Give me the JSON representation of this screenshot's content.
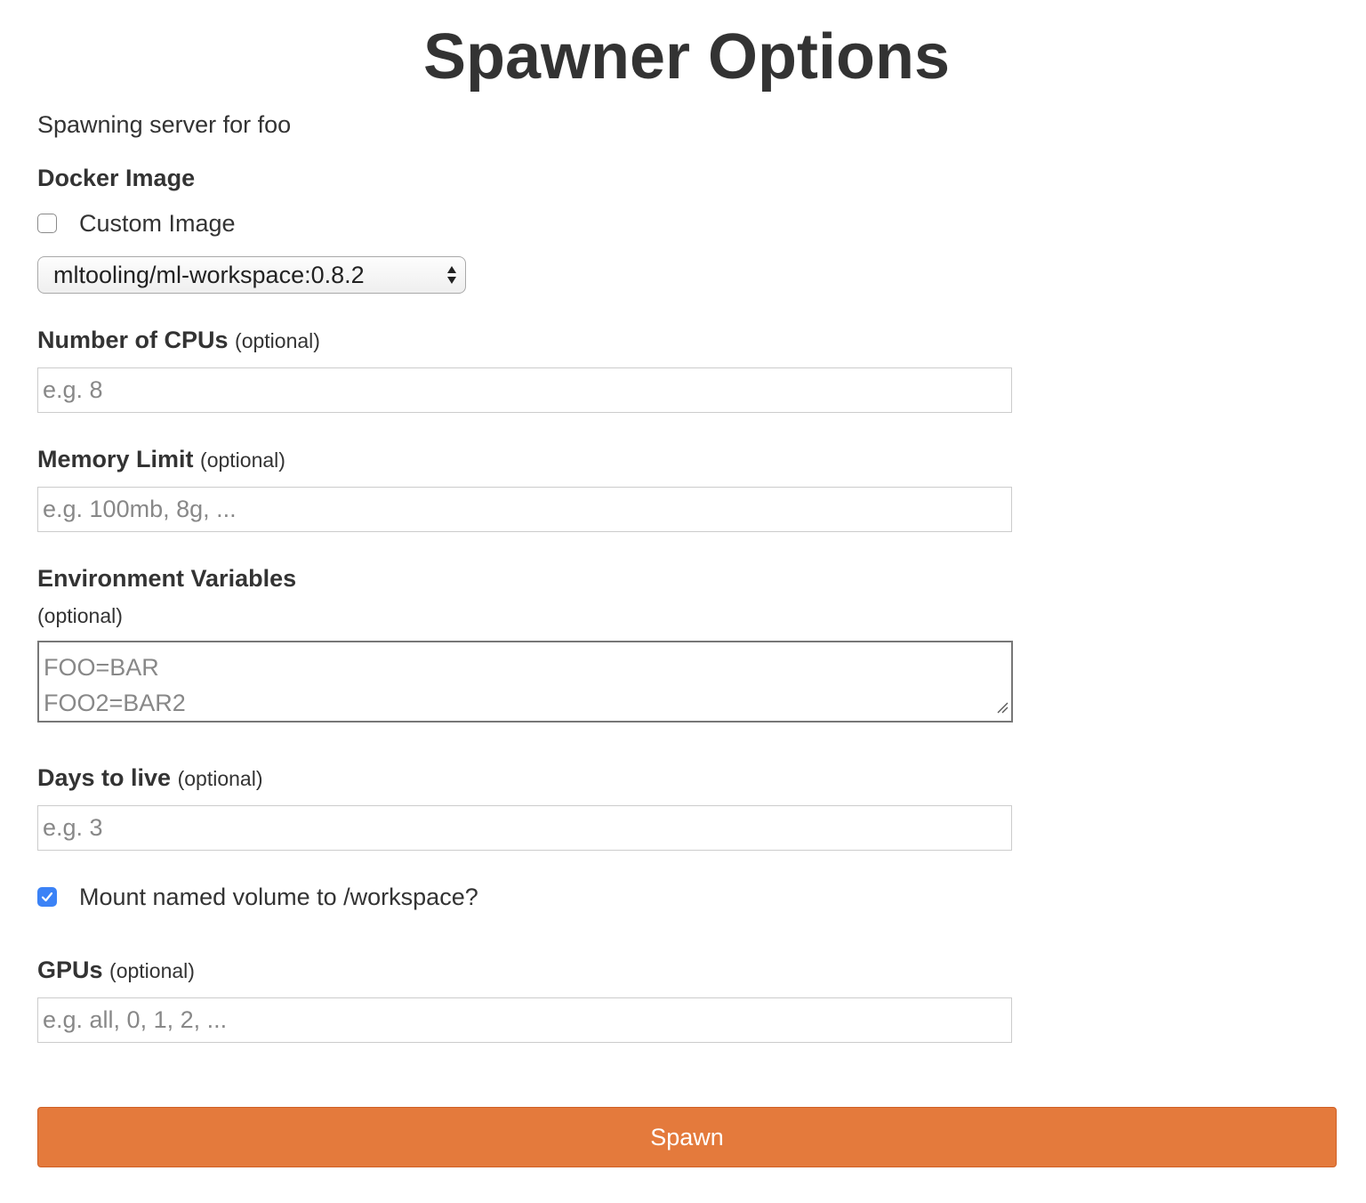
{
  "page": {
    "title": "Spawner Options",
    "subtitle": "Spawning server for foo"
  },
  "docker_image": {
    "label": "Docker Image",
    "custom_image_label": "Custom Image",
    "custom_image_checked": false,
    "selected_image": "mltooling/ml-workspace:0.8.2"
  },
  "cpus": {
    "label": "Number of CPUs",
    "optional": "(optional)",
    "placeholder": "e.g. 8"
  },
  "memory": {
    "label": "Memory Limit",
    "optional": "(optional)",
    "placeholder": "e.g. 100mb, 8g, ..."
  },
  "env_vars": {
    "label": "Environment Variables",
    "optional": "(optional)",
    "placeholder_lines": [
      "FOO=BAR",
      "FOO2=BAR2"
    ]
  },
  "days_to_live": {
    "label": "Days to live",
    "optional": "(optional)",
    "placeholder": "e.g. 3"
  },
  "mount_volume": {
    "label": "Mount named volume to /workspace?",
    "checked": true
  },
  "gpus": {
    "label": "GPUs",
    "optional": "(optional)",
    "placeholder": "e.g. all, 0, 1, 2, ..."
  },
  "submit": {
    "label": "Spawn"
  },
  "colors": {
    "accent": "#e47a3c",
    "checkbox_checked": "#3b82f6",
    "text": "#333333"
  }
}
